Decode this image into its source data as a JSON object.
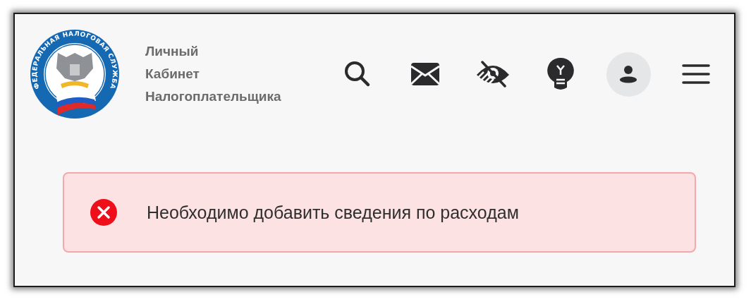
{
  "header": {
    "logo_text": "ФЕДЕРАЛЬНАЯ НАЛОГОВАЯ СЛУЖБА",
    "title_lines": [
      "Личный",
      "Кабинет",
      "Налогоплательщика"
    ]
  },
  "alert": {
    "kind": "error",
    "message": "Необходимо добавить сведения по расходам"
  }
}
